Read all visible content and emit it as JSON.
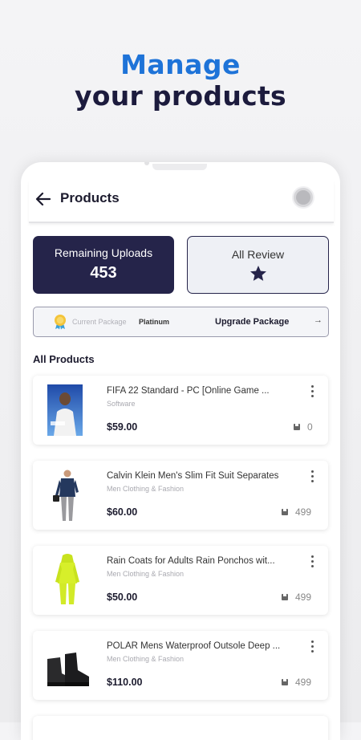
{
  "hero": {
    "line1": "Manage",
    "line2": "your products"
  },
  "appbar": {
    "title": "Products"
  },
  "stats": {
    "uploads_label": "Remaining Uploads",
    "uploads_value": "453",
    "review_label": "All Review"
  },
  "package": {
    "current_label": "Current Package",
    "current_value": "Platinum",
    "upgrade_label": "Upgrade Package",
    "upgrade_arrow": "→"
  },
  "section_title": "All Products",
  "products": [
    {
      "name": "FIFA 22 Standard - PC [Online Game ...",
      "category": "Software",
      "price": "$59.00",
      "stock": "0"
    },
    {
      "name": "Calvin Klein Men's Slim Fit Suit Separates",
      "category": "Men Clothing & Fashion",
      "price": "$60.00",
      "stock": "499"
    },
    {
      "name": "Rain Coats for Adults Rain Ponchos wit...",
      "category": "Men Clothing & Fashion",
      "price": "$50.00",
      "stock": "499"
    },
    {
      "name": "POLAR Mens Waterproof Outsole Deep ...",
      "category": "Men Clothing & Fashion",
      "price": "$110.00",
      "stock": "499"
    }
  ],
  "colors": {
    "accent_blue": "#1e73d8",
    "navy": "#25244a",
    "title_dark": "#1c1b3d"
  },
  "icons": {
    "back": "arrow-left-icon",
    "star": "star-icon",
    "medal": "medal-icon",
    "stock": "box-icon",
    "more": "kebab-menu-icon"
  }
}
